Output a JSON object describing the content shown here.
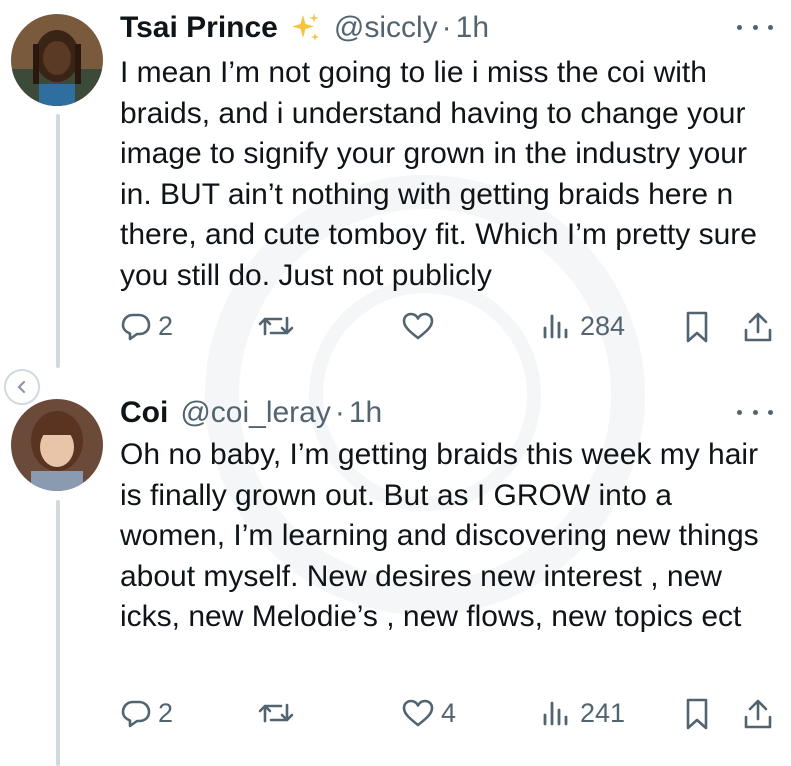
{
  "tweets": [
    {
      "name": "Tsai Prince",
      "badge": "sparkles",
      "handle": "@siccly",
      "separator": "·",
      "time": "1h",
      "text": "I mean I’m not going to lie i miss the coi with braids, and i understand having to change your image to signify your grown in the industry your in. BUT ain’t nothing with getting braids here n there, and cute tomboy fit. Which I’m pretty sure you still do. Just not publicly",
      "actions": {
        "replies": "2",
        "reposts": "",
        "likes": "",
        "views": "284"
      }
    },
    {
      "name": "Coi",
      "handle": "@coi_leray",
      "separator": "·",
      "time": "1h",
      "text": "Oh no baby, I’m getting braids this week my hair is finally grown out. But as I GROW into a women, I’m learning and discovering new things about myself. New desires new interest , new icks, new Melodie’s , new flows, new topics ect",
      "actions": {
        "replies": "2",
        "reposts": "",
        "likes": "4",
        "views": "241"
      }
    }
  ],
  "colors": {
    "text": "#0f1419",
    "secondary": "#536471",
    "thread_line": "#cfd9de",
    "badge": "#f5c542"
  }
}
